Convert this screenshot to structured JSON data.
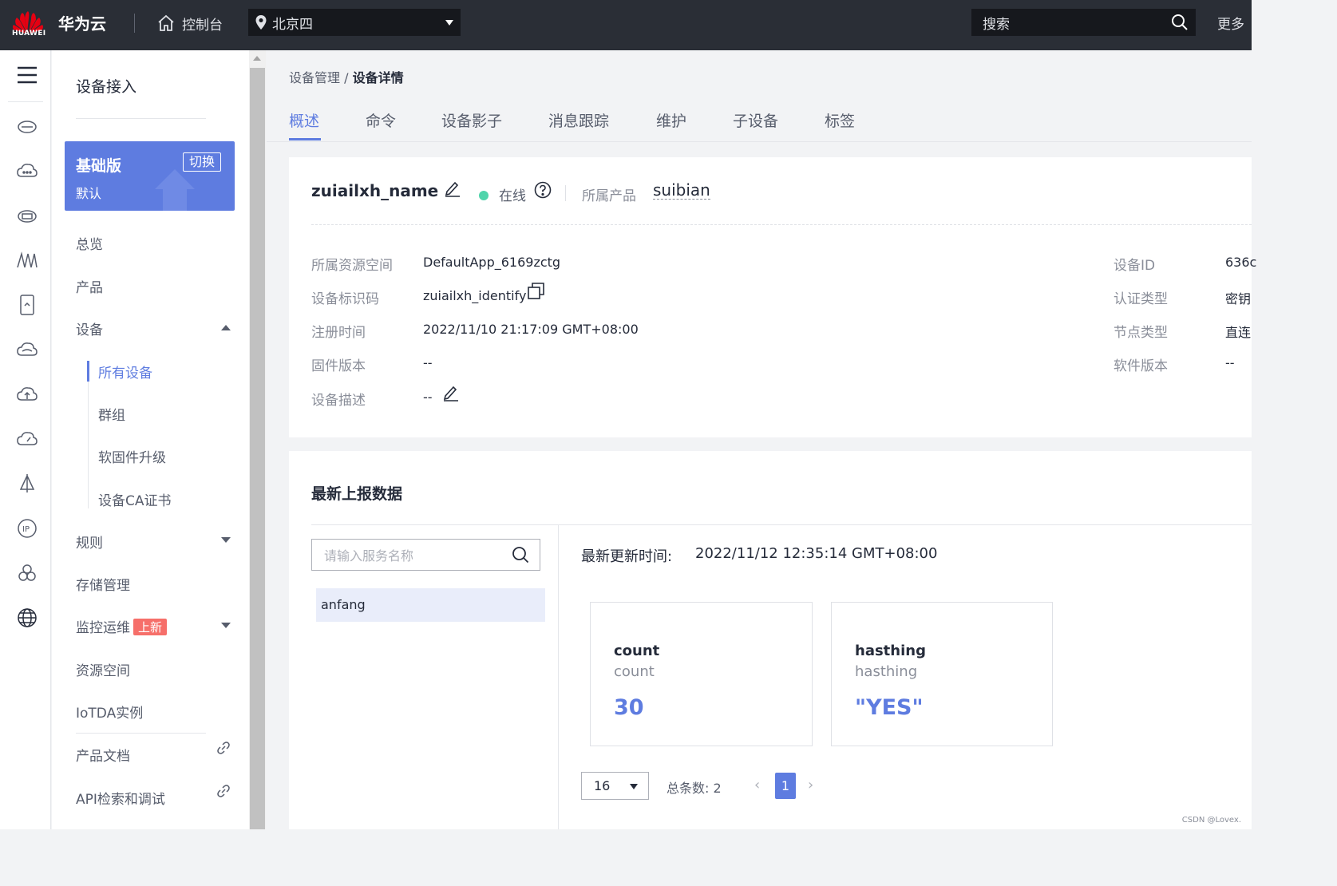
{
  "topbar": {
    "logo_text": "HUAWEI",
    "brand": "华为云",
    "console": "控制台",
    "region": "北京四",
    "search_placeholder": "搜索",
    "more": "更多"
  },
  "sidebar": {
    "title": "设备接入",
    "edition": {
      "name": "基础版",
      "sub": "默认",
      "switch": "切换"
    },
    "items": {
      "overview": "总览",
      "product": "产品",
      "device": "设备",
      "all_devices": "所有设备",
      "group": "群组",
      "firmware": "软固件升级",
      "ca_cert": "设备CA证书",
      "rules": "规则",
      "storage": "存储管理",
      "monitor": "监控运维",
      "monitor_badge": "上新",
      "resource_space": "资源空间",
      "iotda": "IoTDA实例",
      "docs": "产品文档",
      "api": "API检索和调试"
    }
  },
  "breadcrumb": {
    "parent": "设备管理",
    "sep": "/",
    "current": "设备详情"
  },
  "tabs": [
    "概述",
    "命令",
    "设备影子",
    "消息跟踪",
    "维护",
    "子设备",
    "标签"
  ],
  "device": {
    "name": "zuiailxh_name",
    "status": "在线",
    "product_label": "所属产品",
    "product": "suibian",
    "fields_left": [
      {
        "label": "所属资源空间",
        "value": "DefaultApp_6169zctg"
      },
      {
        "label": "设备标识码",
        "value": "zuiailxh_identify"
      },
      {
        "label": "注册时间",
        "value": "2022/11/10 21:17:09 GMT+08:00"
      },
      {
        "label": "固件版本",
        "value": "--"
      },
      {
        "label": "设备描述",
        "value": "--"
      }
    ],
    "fields_right": [
      {
        "label": "设备ID",
        "value": "636c"
      },
      {
        "label": "认证类型",
        "value": "密钥"
      },
      {
        "label": "节点类型",
        "value": "直连"
      },
      {
        "label": "软件版本",
        "value": "--"
      }
    ]
  },
  "report": {
    "title": "最新上报数据",
    "search_placeholder": "请输入服务名称",
    "service": "anfang",
    "updated_label": "最新更新时间:",
    "updated_value": "2022/11/12 12:35:14 GMT+08:00",
    "props": [
      {
        "name": "count",
        "desc": "count",
        "value": "30"
      },
      {
        "name": "hasthing",
        "desc": "hasthing",
        "value": "\"YES\""
      }
    ],
    "pagination": {
      "size": "16",
      "total": "总条数: 2",
      "current": "1",
      "prev": "‹",
      "next": "›"
    }
  },
  "watermark": "CSDN @Lovex.",
  "colors": {
    "accent": "#5e7ce0",
    "topbar": "#2a2e36",
    "online": "#50d4ab",
    "badge": "#f66f6a"
  }
}
